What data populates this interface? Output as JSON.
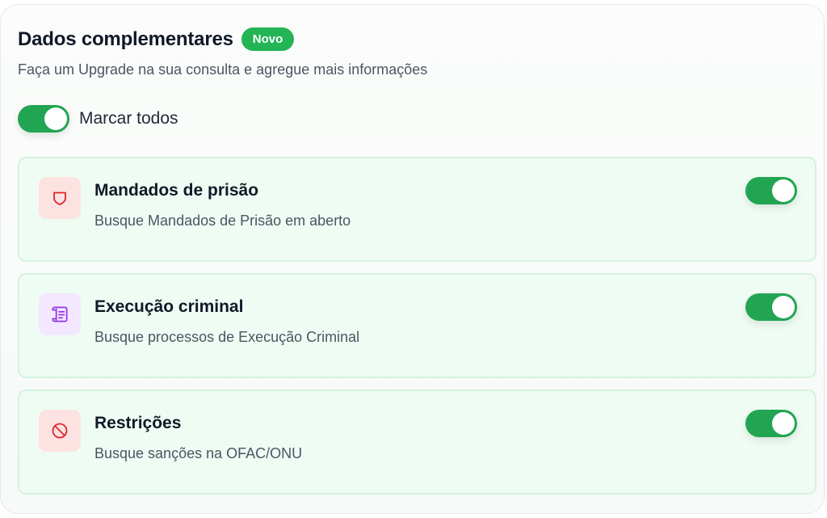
{
  "header": {
    "title": "Dados complementares",
    "badge": "Novo",
    "subtitle": "Faça um Upgrade na sua consulta e agregue mais informações"
  },
  "master_toggle": {
    "label": "Marcar todos",
    "checked": true
  },
  "colors": {
    "accent": "#22a553",
    "badge": "#22b455",
    "card_bg": "#effcf3",
    "card_border": "#d5f2de"
  },
  "items": [
    {
      "title": "Mandados de prisão",
      "description": "Busque Mandados de Prisão em aberto",
      "icon": "shield-icon",
      "icon_color": "#dc2626",
      "icon_bg": "#fde2e2",
      "checked": true
    },
    {
      "title": "Execução criminal",
      "description": "Busque processos de Execução Criminal",
      "icon": "scroll-icon",
      "icon_color": "#9333ea",
      "icon_bg": "#f3e8ff",
      "checked": true
    },
    {
      "title": "Restrições",
      "description": "Busque sanções na OFAC/ONU",
      "icon": "ban-icon",
      "icon_color": "#dc2626",
      "icon_bg": "#fde2e2",
      "checked": true
    }
  ]
}
